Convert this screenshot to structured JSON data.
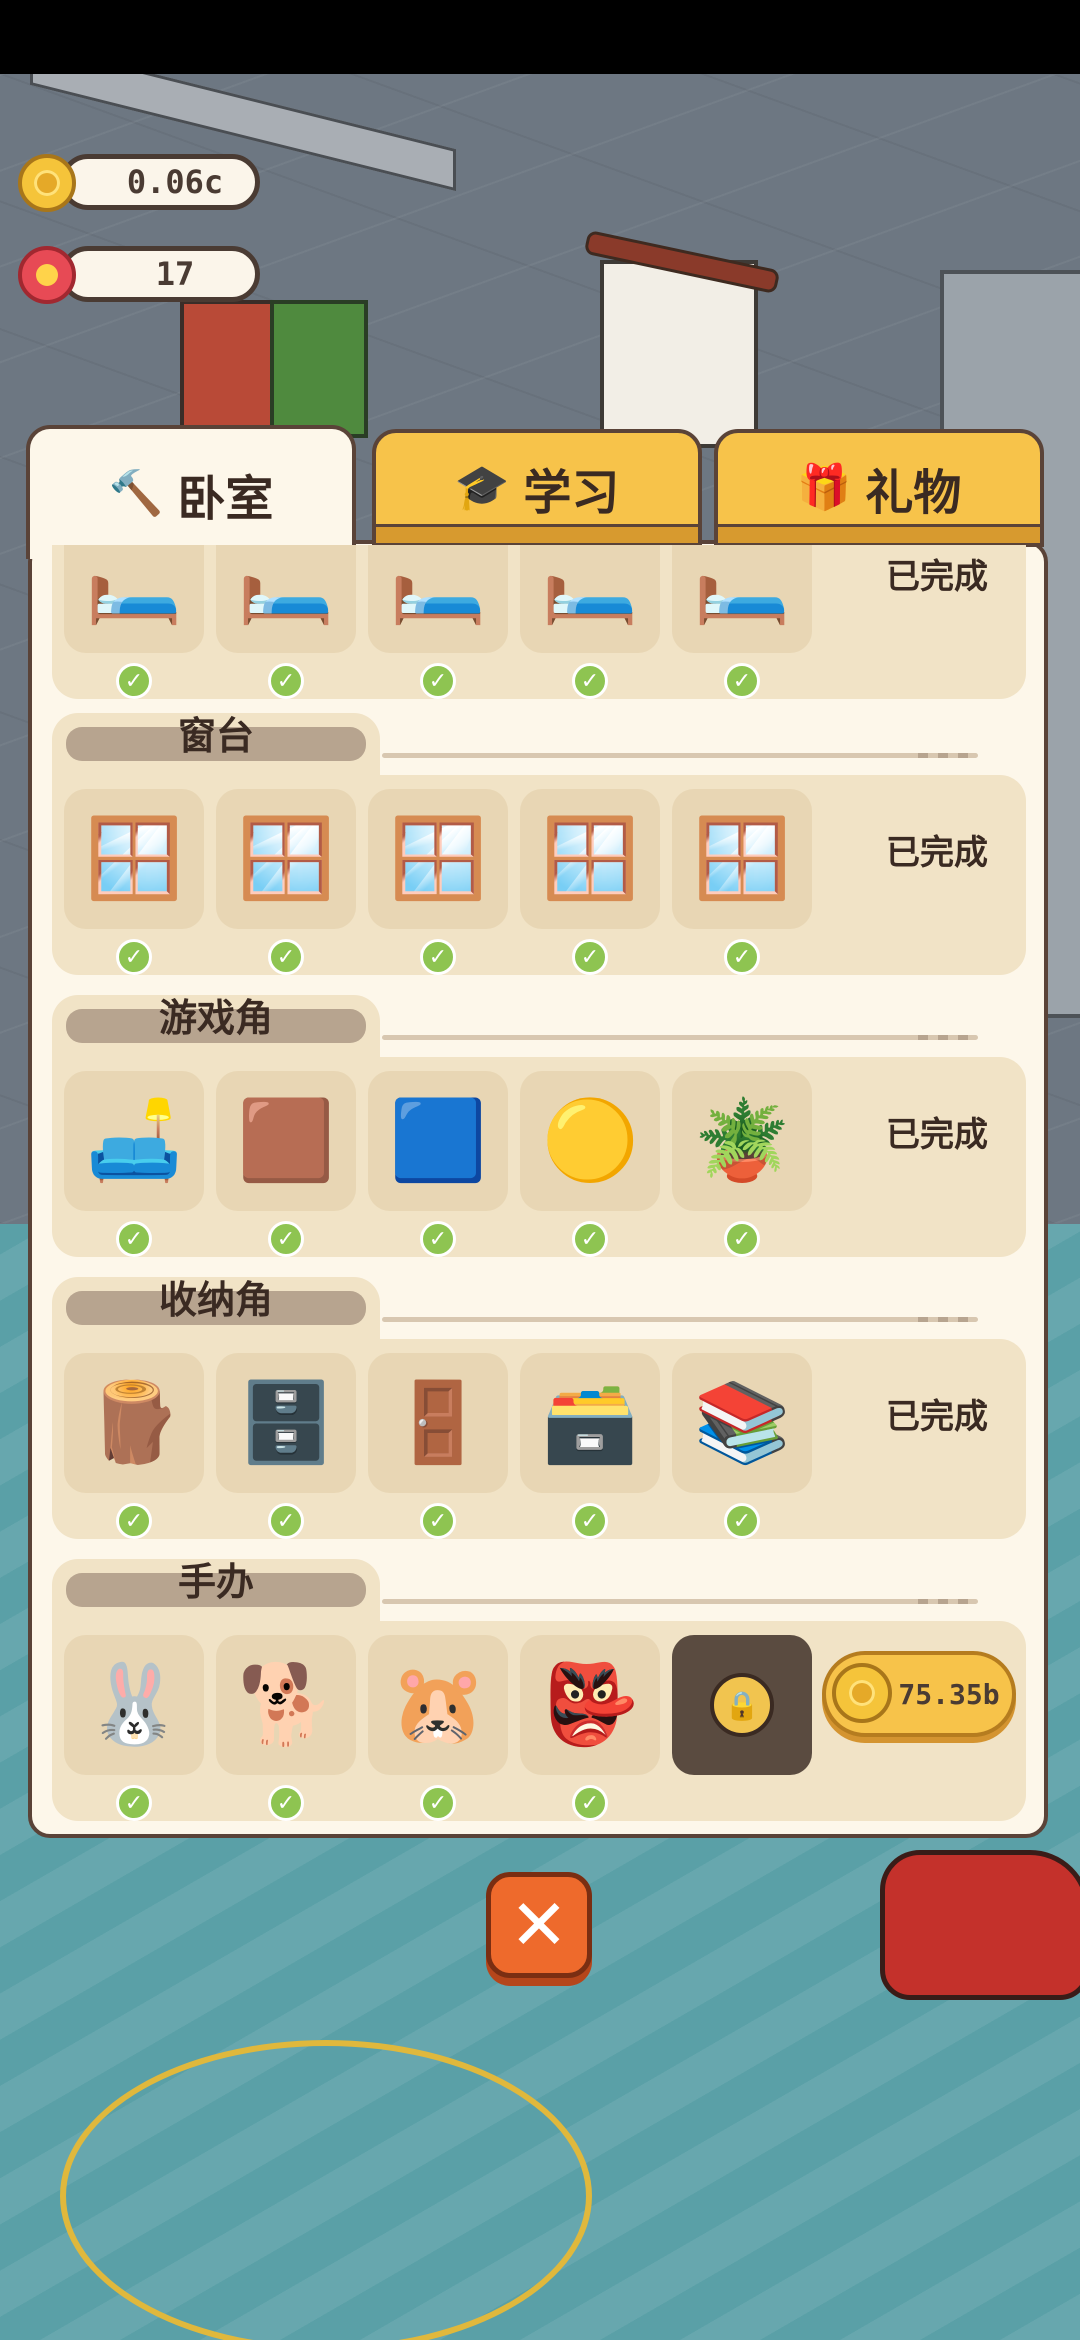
{
  "currency": {
    "coins": "0.06c",
    "flowers": "17"
  },
  "tabs": [
    {
      "label": "卧室",
      "icon": "hammer-icon",
      "active": true
    },
    {
      "label": "学习",
      "icon": "graduation-cap-icon",
      "active": false
    },
    {
      "label": "礼物",
      "icon": "gift-icon",
      "active": false
    }
  ],
  "sections": [
    {
      "title": "",
      "items": [
        "🛏️",
        "🛏️",
        "🛏️",
        "🛏️",
        "🛏️"
      ],
      "checked": [
        true,
        true,
        true,
        true,
        true
      ],
      "status": "已完成"
    },
    {
      "title": "窗台",
      "items": [
        "🪟",
        "🪟",
        "🪟",
        "🪟",
        "🪟"
      ],
      "checked": [
        true,
        true,
        true,
        true,
        true
      ],
      "status": "已完成"
    },
    {
      "title": "游戏角",
      "items": [
        "🛋️",
        "🟫",
        "🟦",
        "🟡",
        "🪴"
      ],
      "checked": [
        true,
        true,
        true,
        true,
        true
      ],
      "status": "已完成"
    },
    {
      "title": "收纳角",
      "items": [
        "🪵",
        "🗄️",
        "🚪",
        "🗃️",
        "📚"
      ],
      "checked": [
        true,
        true,
        true,
        true,
        true
      ],
      "status": "已完成"
    },
    {
      "title": "手办",
      "items": [
        "🐰",
        "🐕",
        "🐹",
        "👺",
        "🔒"
      ],
      "checked": [
        true,
        true,
        true,
        true,
        false
      ],
      "price": "75.35b"
    }
  ],
  "close_symbol": "✕",
  "check_symbol": "✓",
  "lock_symbol": "🔒"
}
